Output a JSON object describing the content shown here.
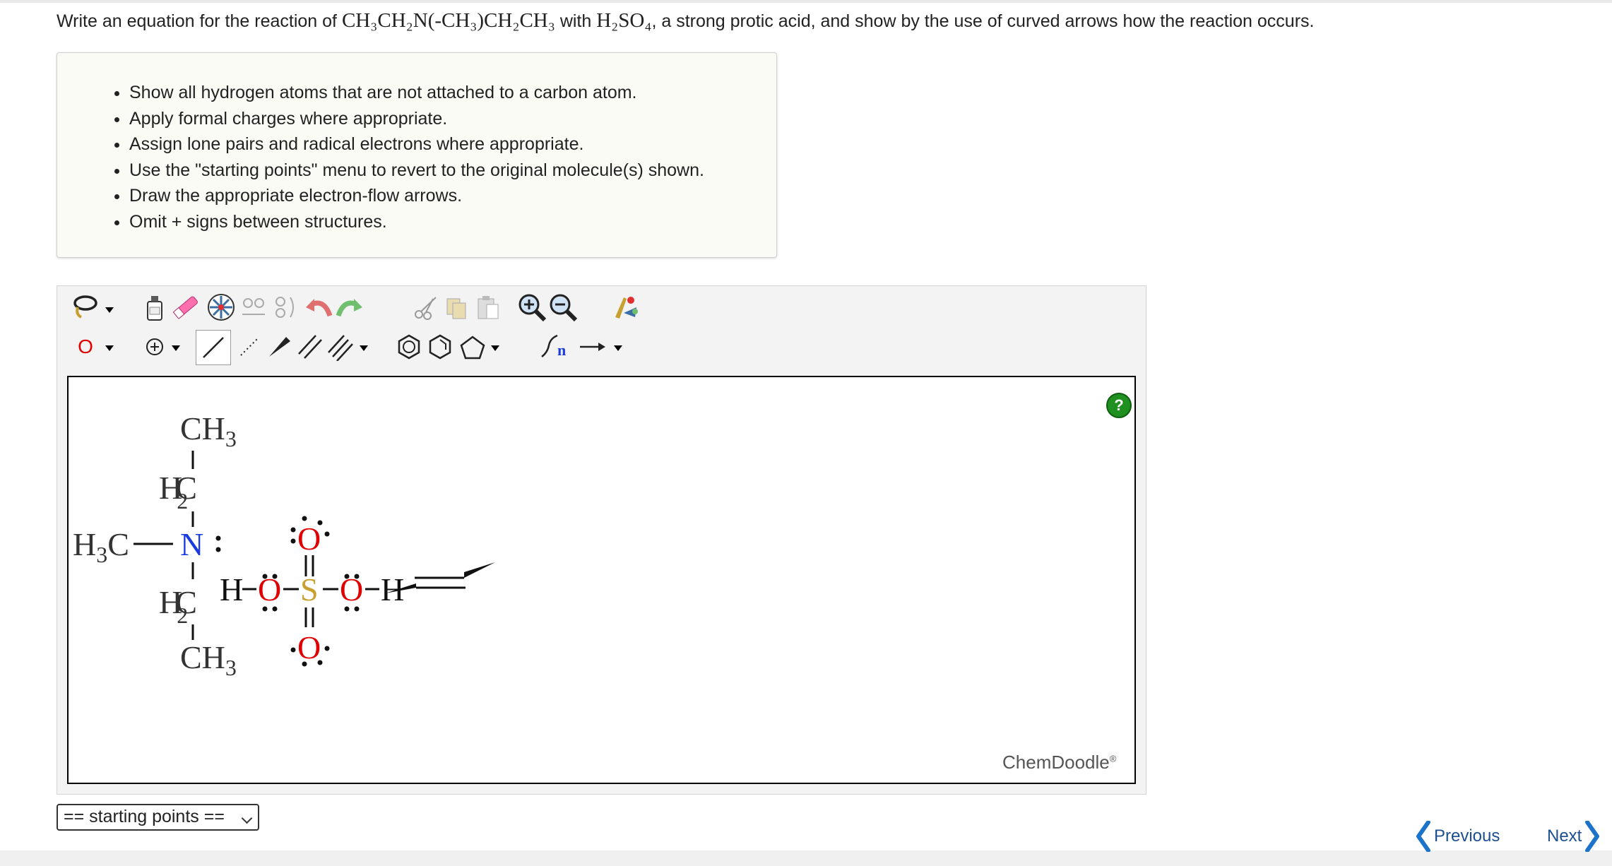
{
  "question": {
    "prefix": "Write an equation for the reaction of",
    "reactant_formula": "CH₃CH₂N(-CH₃)CH₂CH₃",
    "middle": "with",
    "acid_formula": "H₂SO₄",
    "suffix": ", a strong protic acid, and show by the use of curved arrows how the reaction occurs."
  },
  "instructions": [
    "Show all hydrogen atoms that are not attached to a carbon atom.",
    "Apply formal charges where appropriate.",
    "Assign lone pairs and radical electrons where appropriate.",
    "Use the \"starting points\" menu to revert to the original molecule(s) shown.",
    "Draw the appropriate electron-flow arrows.",
    "Omit + signs between structures."
  ],
  "toolbar": {
    "row1": [
      "lasso-tool",
      "clear-tool",
      "eraser-tool",
      "center-tool",
      "flip-horizontal-tool",
      "flip-vertical-tool",
      "undo-tool",
      "redo-tool",
      "cut-tool",
      "copy-tool",
      "paste-tool",
      "zoom-in-tool",
      "zoom-out-tool",
      "clean-tool"
    ],
    "row2": [
      "atom-label-tool",
      "charge-tool",
      "single-bond-tool",
      "dashed-bond-tool",
      "wedge-bond-tool",
      "double-bond-tool",
      "triple-bond-tool",
      "benzene-tool",
      "hexagon-tool",
      "pentagon-tool",
      "chain-tool",
      "arrow-tool"
    ],
    "atom_label": "O",
    "chain_label": "n"
  },
  "molecules": {
    "amine": {
      "top_ch3": {
        "main": "CH",
        "sub": "3"
      },
      "h2c_top": {
        "main": "H",
        "sub": "2",
        "c": "C"
      },
      "h3c": {
        "h": "H",
        "sub": "3",
        "c": "C"
      },
      "n": "N",
      "h2c_bottom": {
        "main": "H",
        "sub": "2",
        "c": "C"
      },
      "bottom_ch3": {
        "main": "CH",
        "sub": "3"
      }
    },
    "sulfuric_acid": {
      "h_left": "H",
      "o_left": "O",
      "s": "S",
      "o_right": "O",
      "h_right": "H",
      "o_top": "O",
      "o_bottom": "O"
    }
  },
  "colors": {
    "nitrogen": "#1a3be0",
    "oxygen": "#e00000",
    "sulfur": "#c8a030",
    "help": "#1f8f1f",
    "link": "#1c4f8f"
  },
  "help_label": "?",
  "brand": {
    "name": "ChemDoodle",
    "mark": "®"
  },
  "starting_points": "== starting points ==",
  "nav": {
    "previous": "Previous",
    "next": "Next"
  }
}
